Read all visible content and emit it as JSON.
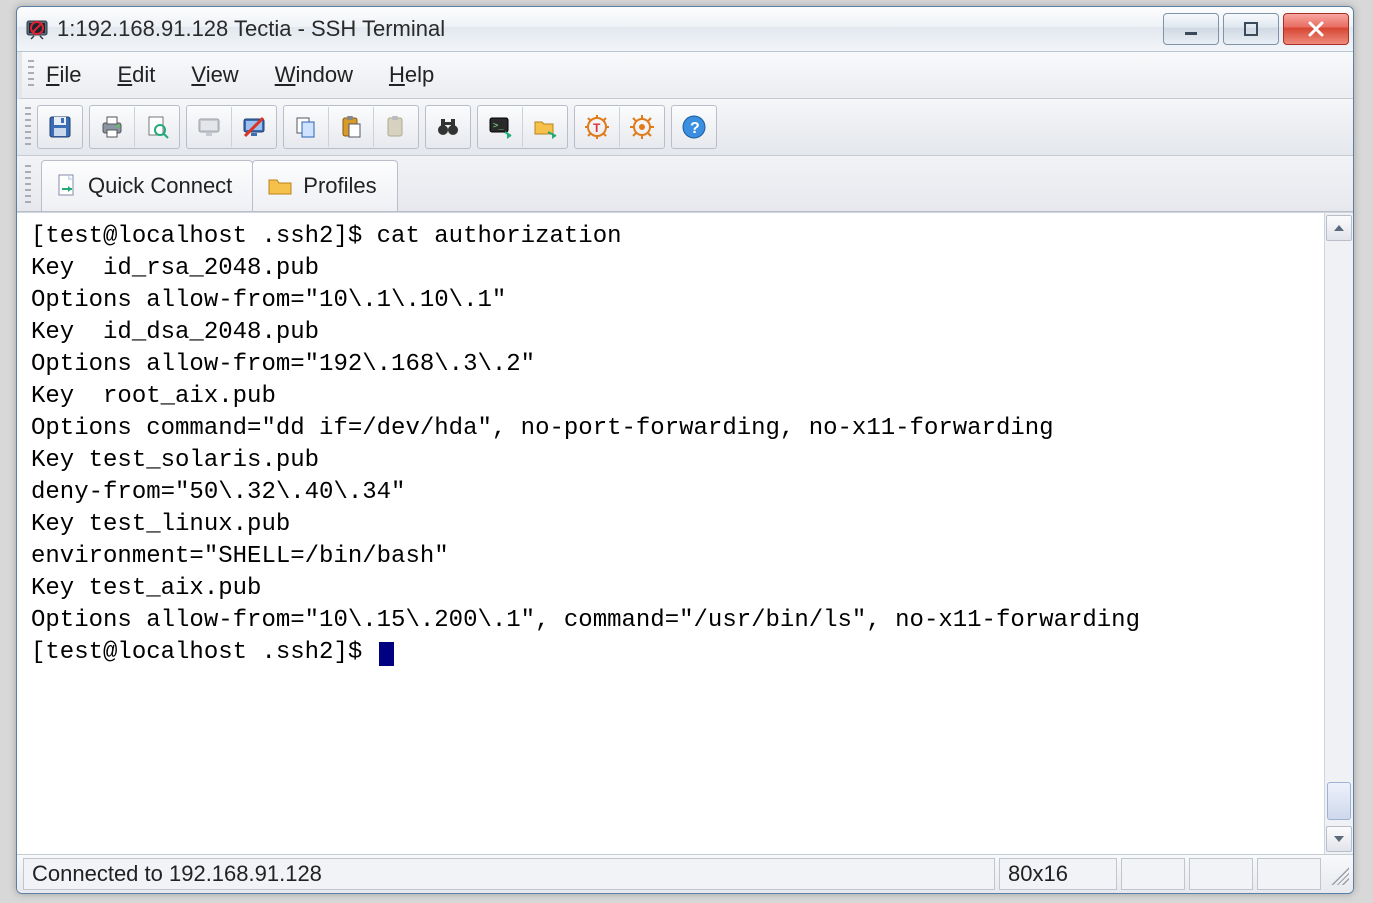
{
  "window": {
    "title": "1:192.168.91.128 Tectia - SSH Terminal"
  },
  "menu": {
    "file": "File",
    "edit": "Edit",
    "view": "View",
    "window": "Window",
    "help": "Help"
  },
  "toolbar": {
    "icons": {
      "save": "save-icon",
      "print": "print-icon",
      "print_preview": "print-preview-icon",
      "monitor_gray": "monitor-gray-icon",
      "monitor_red": "monitor-disconnect-icon",
      "copy": "copy-icon",
      "paste": "paste-icon",
      "paste_gray": "paste-disabled-icon",
      "find": "binoculars-icon",
      "terminal": "terminal-icon",
      "folder_transfer": "folder-transfer-icon",
      "gear_t": "tectia-settings-icon",
      "gear": "settings-icon",
      "help": "help-icon"
    }
  },
  "tabs": {
    "quick_connect": "Quick Connect",
    "profiles": "Profiles"
  },
  "terminal": {
    "lines": [
      "[test@localhost .ssh2]$ cat authorization",
      "Key  id_rsa_2048.pub",
      "Options allow-from=\"10\\.1\\.10\\.1\"",
      "Key  id_dsa_2048.pub",
      "Options allow-from=\"192\\.168\\.3\\.2\"",
      "Key  root_aix.pub",
      "Options command=\"dd if=/dev/hda\", no-port-forwarding, no-x11-forwarding",
      "Key test_solaris.pub",
      "deny-from=\"50\\.32\\.40\\.34\"",
      "Key test_linux.pub",
      "environment=\"SHELL=/bin/bash\"",
      "Key test_aix.pub",
      "Options allow-from=\"10\\.15\\.200\\.1\", command=\"/usr/bin/ls\", no-x11-forwarding"
    ],
    "prompt": "[test@localhost .ssh2]$ "
  },
  "status": {
    "connection": "Connected to 192.168.91.128",
    "dimensions": "80x16"
  }
}
